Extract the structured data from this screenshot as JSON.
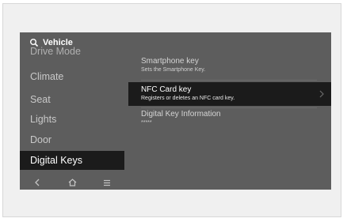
{
  "header": {
    "title": "Vehicle",
    "icon": "search-icon"
  },
  "sidebar": {
    "items": [
      {
        "label": "Drive Mode"
      },
      {
        "label": "Climate"
      },
      {
        "label": "Seat"
      },
      {
        "label": "Lights"
      },
      {
        "label": "Door"
      },
      {
        "label": "Digital Keys",
        "active": true
      }
    ]
  },
  "bottom_nav": {
    "icons": [
      "back-icon",
      "home-icon",
      "menu-icon"
    ]
  },
  "content": {
    "rows": [
      {
        "title": "Smartphone key",
        "subtitle": "Sets the Smartphone Key."
      },
      {
        "title": "NFC Card key",
        "subtitle": "Registers or deletes an NFC card key.",
        "active": true
      },
      {
        "title": "Digital Key Information",
        "subtitle": "*****"
      }
    ]
  },
  "colors": {
    "screen_bg": "#5d5d5d",
    "active_bg": "#1b1b1b",
    "text": "#ffffff"
  }
}
